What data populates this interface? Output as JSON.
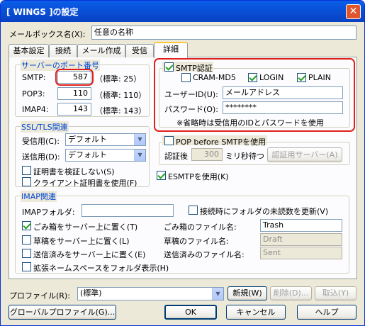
{
  "window": {
    "title": "[ WINGS ]の設定",
    "close": "✕"
  },
  "mailbox": {
    "label": "メールボックス名(X):",
    "value": "任意の名称"
  },
  "tabs": [
    {
      "label": "基本設定"
    },
    {
      "label": "接続"
    },
    {
      "label": "メール作成"
    },
    {
      "label": "受信"
    },
    {
      "label": "詳細"
    }
  ],
  "ports": {
    "group": "サーバーのポート番号",
    "rows": [
      {
        "label": "SMTP:",
        "value": "587",
        "default": "（標準: 25）"
      },
      {
        "label": "POP3:",
        "value": "110",
        "default": "（標準: 110）"
      },
      {
        "label": "IMAP4:",
        "value": "143",
        "default": "（標準: 143）"
      }
    ]
  },
  "ssl": {
    "group": "SSL/TLS関連",
    "receive_label": "受信用(C):",
    "receive_value": "デフォルト",
    "send_label": "送信用(D):",
    "send_value": "デフォルト",
    "no_verify": "証明書を検証しない(S)",
    "client_cert": "クライアント証明書を使用(F)"
  },
  "smtp_auth": {
    "label": "SMTP認証",
    "cram": "CRAM-MD5",
    "login": "LOGIN",
    "plain": "PLAIN",
    "userid_label": "ユーザーID(U):",
    "userid_value": "メールアドレス",
    "password_label": "パスワード(O):",
    "password_value": "********",
    "note": "※省略時は受信用のIDとパスワードを使用"
  },
  "pop_before": {
    "label": "POP before SMTPを使用",
    "after_label": "認証後",
    "wait_value": "300",
    "wait_unit": "ミリ秒待つ",
    "server_button": "認証用サーバー(A)"
  },
  "esmtp": {
    "label": "ESMTPを使用(K)"
  },
  "imap": {
    "group": "IMAP関連",
    "folder_label": "IMAPフォルダ:",
    "folder_value": "",
    "update_unread": "接続時にフォルダの未読数を更新(V)",
    "trash_on_server": "ごみ箱をサーバー上に置く(T)",
    "trash_name_label": "ごみ箱のファイル名:",
    "trash_name_value": "Trash",
    "draft_on_server": "草稿をサーバー上に置く(L)",
    "draft_name_label": "草稿のファイル名:",
    "draft_name_value": "Draft",
    "sent_on_server": "送信済みをサーバー上に置く(E)",
    "sent_name_label": "送信済みのファイル名:",
    "sent_name_value": "Sent",
    "ext_namespace": "拡張ネームスペースをフォルダ表示(H)"
  },
  "profile": {
    "label": "プロファイル(R):",
    "value": "(標準)",
    "new": "新規(W)",
    "delete": "削除(D)...",
    "import": "取込(Y)"
  },
  "buttons": {
    "global": "グローバルプロファイル(G)...",
    "ok": "OK",
    "cancel": "キャンセル",
    "help": "ヘルプ"
  },
  "colors": {
    "accent": "#0a4fd6",
    "group_label": "#0046d5",
    "highlight": "#e0201b"
  }
}
